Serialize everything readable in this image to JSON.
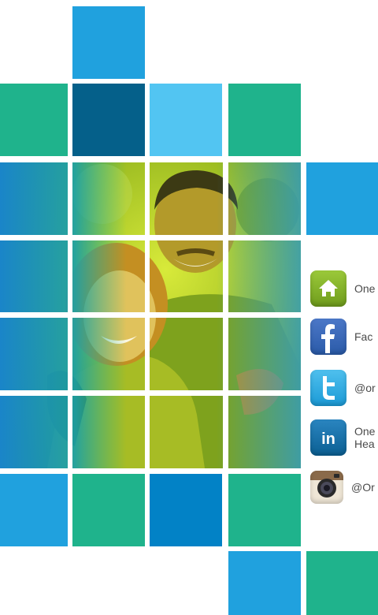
{
  "colors": {
    "teal": "#1fb38c",
    "sky": "#20a1de",
    "navy": "#05608a",
    "light_blue": "#52c5f2",
    "mid_blue": "#0282c6"
  },
  "photo": {
    "icon": "couple-photo",
    "tint": "green-yellow duotone"
  },
  "social_links": [
    {
      "icon": "home-icon",
      "label": "One"
    },
    {
      "icon": "facebook-icon",
      "label": "Fac"
    },
    {
      "icon": "twitter-icon",
      "label": "@or"
    },
    {
      "icon": "linkedin-icon",
      "label": "One",
      "label2": "Hea"
    },
    {
      "icon": "instagram-icon",
      "label": "@Or"
    }
  ]
}
